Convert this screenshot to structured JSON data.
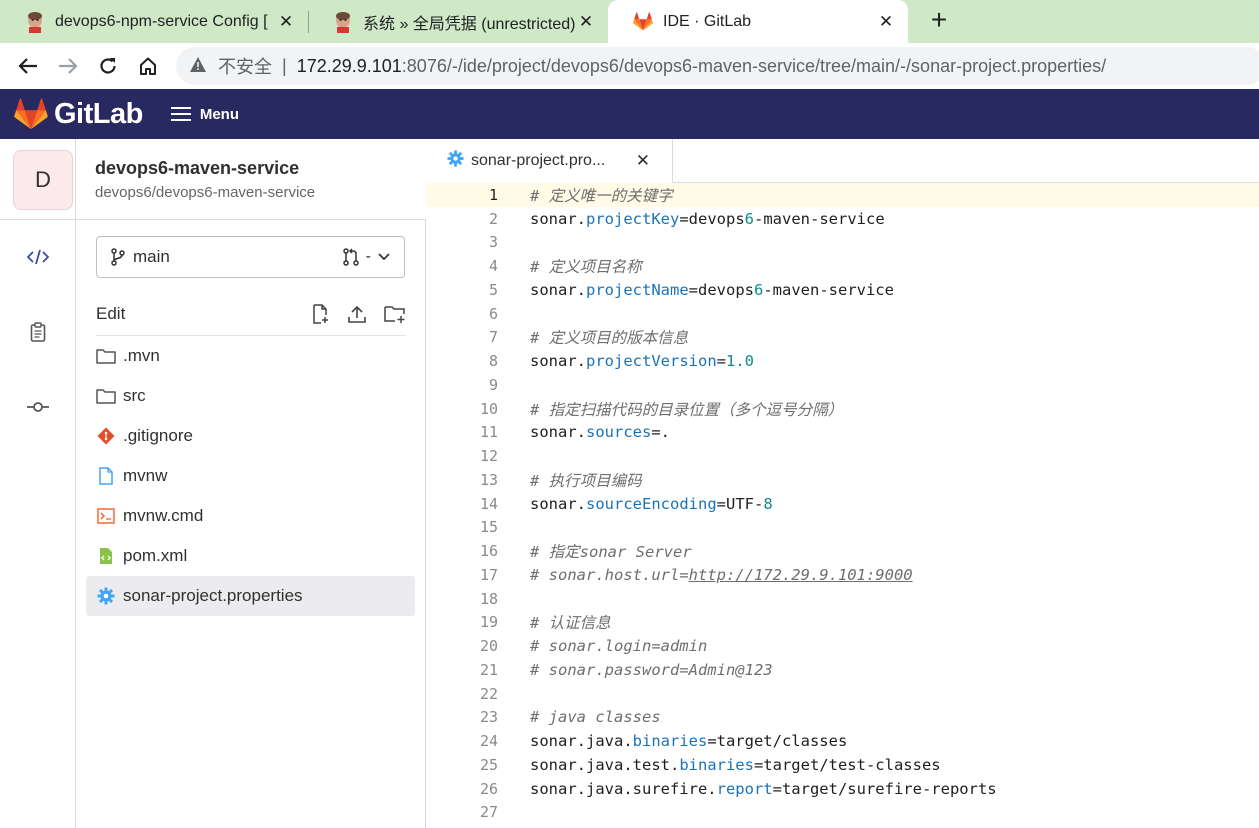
{
  "browser": {
    "tabs": [
      {
        "title": "devops6-npm-service Config [",
        "icon": "jenkins-icon"
      },
      {
        "title": "系统 » 全局凭据 (unrestricted) [",
        "icon": "jenkins-icon"
      },
      {
        "title": "IDE · GitLab",
        "icon": "gitlab-icon",
        "active": true
      }
    ],
    "address": {
      "insecure_label": "不安全",
      "host": "172.29.9.101",
      "path": ":8076/-/ide/project/devops6/devops6-maven-service/tree/main/-/sonar-project.properties/"
    }
  },
  "gitlab": {
    "brand": "GitLab",
    "menu_label": "Menu"
  },
  "project": {
    "avatar_letter": "D",
    "name": "devops6-maven-service",
    "path": "devops6/devops6-maven-service"
  },
  "branch": {
    "name": "main",
    "mr_label": "-"
  },
  "edit_label": "Edit",
  "files": [
    {
      "name": ".mvn",
      "icon": "folder-icon"
    },
    {
      "name": "src",
      "icon": "folder-icon"
    },
    {
      "name": ".gitignore",
      "icon": "git-icon"
    },
    {
      "name": "mvnw",
      "icon": "file-icon"
    },
    {
      "name": "mvnw.cmd",
      "icon": "terminal-icon"
    },
    {
      "name": "pom.xml",
      "icon": "xml-icon"
    },
    {
      "name": "sonar-project.properties",
      "icon": "gear-icon",
      "active": true
    }
  ],
  "editor": {
    "tab_name": "sonar-project.pro...",
    "current_line": 1,
    "lines": [
      "# 定义唯一的关键字",
      "sonar.projectKey=devops6-maven-service",
      "",
      "# 定义项目名称",
      "sonar.projectName=devops6-maven-service",
      "",
      "# 定义项目的版本信息",
      "sonar.projectVersion=1.0",
      "",
      "# 指定扫描代码的目录位置（多个逗号分隔）",
      "sonar.sources=.",
      "",
      "# 执行项目编码",
      "sonar.sourceEncoding=UTF-8",
      "",
      "# 指定sonar Server",
      "# sonar.host.url=http://172.29.9.101:9000",
      "",
      "# 认证信息",
      "# sonar.login=admin",
      "# sonar.password=Admin@123",
      "",
      "# java classes",
      "sonar.java.binaries=target/classes",
      "sonar.java.test.binaries=target/test-classes",
      "sonar.java.surefire.report=target/surefire-reports",
      ""
    ]
  }
}
